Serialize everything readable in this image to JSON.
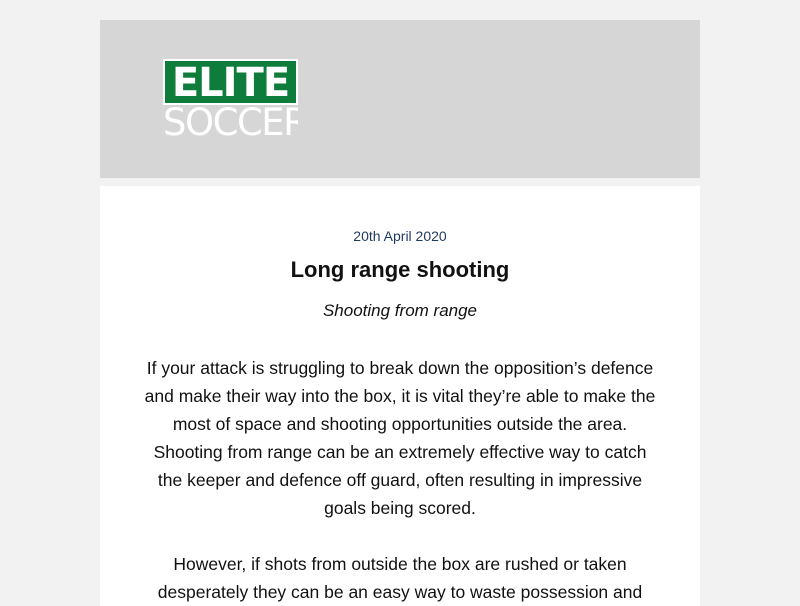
{
  "header": {
    "logo_top": "ELITE",
    "logo_bottom": "SOCCER",
    "brand_color": "#0e7c3a"
  },
  "article": {
    "date": "20th April 2020",
    "title": "Long range shooting",
    "subtitle": "Shooting from range",
    "paragraphs": [
      "If your attack is struggling to break down the opposition’s defence and make their way into the box, it is vital they’re able to make the most of space and shooting opportunities outside the area. Shooting from range can be an extremely effective way to catch the keeper and defence off guard, often resulting in impressive goals being scored.",
      "However, if shots from outside the box are rushed or taken desperately they can be an easy way to waste possession and"
    ]
  }
}
